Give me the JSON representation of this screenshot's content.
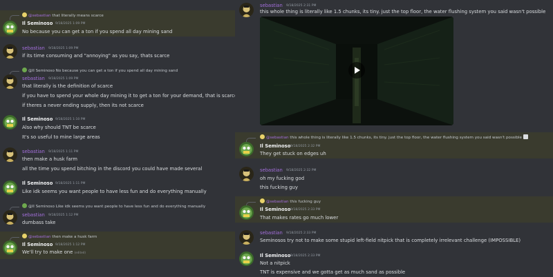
{
  "left": {
    "messages": [
      {
        "reply_name": "@sebastian",
        "reply_text": "that literally means scarce",
        "name": "Il Seminoso",
        "time": "9/18/2025 1:09 PM",
        "lines": [
          "No because you can get a ton if you spend all day mining sand"
        ]
      },
      {
        "name": "sebastian",
        "time": "9/18/2025 1:09 PM",
        "lines": [
          "if its time consuming and \"annoying\" as you say, thats scarce"
        ]
      },
      {
        "reply_name": "@Il Seminoso",
        "reply_text": "No because you can get a ton if you spend all day mining sand",
        "name": "sebastian",
        "time": "9/18/2025 1:09 PM",
        "lines": [
          "that literally is the definition of scarce",
          "if you have to spend your whole day mining it to get a ton for your demand, that is scarce",
          "if theres a never ending supply, then its not scarce"
        ]
      },
      {
        "name": "Il Seminoso",
        "time": "9/18/2025 1:10 PM",
        "lines": [
          "Also why should TNT be scarce",
          "It's so useful to mine large areas"
        ]
      },
      {
        "name": "sebastian",
        "time": "9/18/2025 1:11 PM",
        "lines": [
          "then make a husk farm",
          "all the time you spend bitching in the discord you could have made several"
        ]
      },
      {
        "name": "Il Seminoso",
        "time": "9/18/2025 1:11 PM",
        "lines": [
          "Like idk seems you want people to have less fun and do everything manually"
        ]
      },
      {
        "reply_name": "@Il Seminoso",
        "reply_text": "Like idk seems you want people to have less fun and do everything manually",
        "name": "sebastian",
        "time": "9/18/2025 1:12 PM",
        "lines": [
          "dumbass take"
        ]
      },
      {
        "reply_name": "@sebastian",
        "reply_text": "then make a husk farm",
        "name": "Il Seminoso",
        "time": "9/18/2025 1:12 PM",
        "lines": [
          "We'll try to make one"
        ],
        "edited": "(edited)"
      }
    ]
  },
  "right": {
    "messages": [
      {
        "name": "sebastian",
        "time": "9/18/2025 2:31 PM",
        "lines": [
          "this whole thing is literally like 1.5 chunks, its tiny. just the top floor, the water flushing system you said wasn't possible"
        ]
      },
      {
        "reply_name": "@sebastian",
        "reply_text": "this whole thing is literally like 1.5 chunks, its tiny. just the top floor, the water flushing system you said wasn't possible",
        "name": "Il Seminoso",
        "time": "9/18/2025 2:32 PM",
        "lines": [
          "They get stuck on edges uh"
        ]
      },
      {
        "name": "sebastian",
        "time": "9/18/2025 2:32 PM",
        "lines": [
          "oh my fucking god",
          "this fucking guy"
        ]
      },
      {
        "reply_name": "@sebastian",
        "reply_text": "this fucking guy",
        "name": "Il Seminoso",
        "time": "9/18/2025 2:33 PM",
        "lines": [
          "That makes rates go much lower"
        ]
      },
      {
        "name": "sebastian",
        "time": "9/18/2025 2:33 PM",
        "lines": [
          "Seminosos try not to make some stupid left-field nitpick that is completely irrelevant challenge (IMPOSSIBLE)"
        ]
      },
      {
        "name": "Il Seminoso",
        "time": "9/18/2025 2:33 PM",
        "lines": [
          "Not a nitpick",
          "TNT is expensive and we gotta get as much sand as possible"
        ]
      }
    ]
  },
  "colors": {
    "sebastian": "#a46fdc",
    "il_seminoso": "#f2f3f5",
    "mention_highlight": "#3a3b2e",
    "background": "#313338"
  },
  "icons": {
    "avatar_sebastian": "dark-portrait-avatar",
    "avatar_il": "green-yellow-creature-avatar",
    "video_play": "play-icon",
    "attachment": "image-icon"
  }
}
